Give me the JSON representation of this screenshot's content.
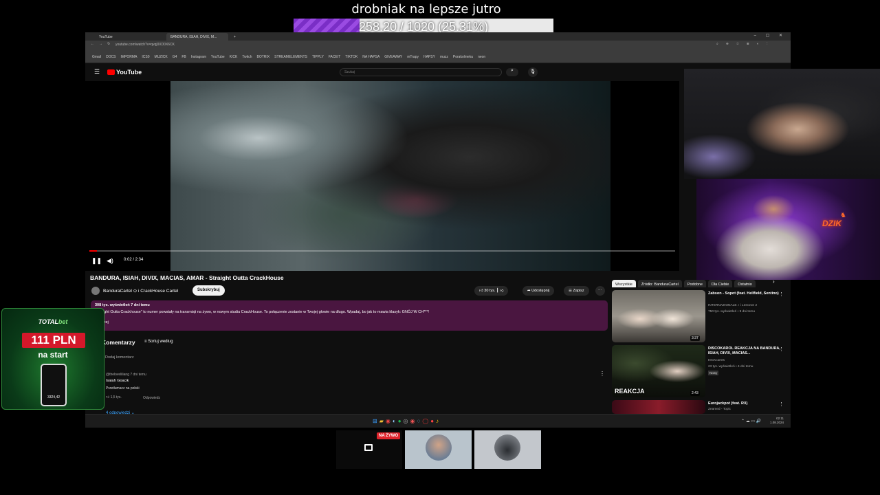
{
  "goal": {
    "title": "drobniak na lepsze jutro",
    "text": "258.20 / 1020 (25.31%)",
    "fraction": 0.2531
  },
  "browser": {
    "tabs": [
      "YouTube",
      "BANDURA, ISIAH, DIVIX, M..."
    ],
    "url": "youtube.com/watch?v=qvqj0XD0X6CK",
    "bookmarks": [
      "Gmail",
      "DOCS",
      "IMPORMA",
      "ICS0",
      "MUZICK",
      "G4",
      "FB",
      "Instagram",
      "YouTube",
      "KICK",
      "Twitch",
      "BOTRIX",
      "STREAMELEMENTS",
      "TIPPLY",
      "FACEIT",
      "TIKTOK",
      "NA HAPSA",
      "GIVEAWAY",
      "mTrapy",
      "HAPSY",
      "muzz",
      "Porakolmeku",
      "neon"
    ]
  },
  "youtube": {
    "logo": "YouTube",
    "search_placeholder": "Szukaj",
    "video": {
      "time": "0:02 / 2:34",
      "played_fraction": 0.013,
      "title": "BANDURA, ISIAH, DIVIX, MACIAS, AMAR - Straight Outta CrackHouse",
      "channel": "BanduraCartel ⊙ i CrackHouse Cartel",
      "subscribe": "Subskrybuj",
      "likes": "30 tys.",
      "share": "Udostępnij",
      "save": "Zapisz",
      "desc_stats": "308 tys. wyświetleń  7 dni temu",
      "desc_body": "\"Straight Outta Crackhouse\" to numer powstały na transmisji na żywo, w nowym studiu CrackHouse. To połączenie zostanie w Twojej głowie na długo. Wpadaj, bo jak to mawia klasyk: GNÓJ W CH***!",
      "desc_more": "...więcej"
    },
    "comments": {
      "heading": "Komentarzy",
      "sort": "Sortuj według",
      "add": "Dodaj komentarz",
      "user": "@theloveliliang  7 dni temu",
      "name": "Isaiah Goacik",
      "text": "Przetłumacz na polski",
      "likes": "1,5 tys.",
      "reply": "Odpowiedz",
      "replies": "4 odpowiedzi"
    },
    "chips": [
      "Wszystkie",
      "Źródło: BanduraCartel",
      "Podobne",
      "Dla Ciebie",
      "Ostatnio"
    ],
    "recommendations": [
      {
        "title": "Zabson - Sopot (feat. Hellfield, Sentino)",
        "channel": "INTERNAZIONALE ♪ i Leeczon 2",
        "meta": "750 tys. wyświetleń • 9 dni temu",
        "duration": "3:37",
        "badge": ""
      },
      {
        "title": "DISCOKAROL REAKCJA NA BANDURA, ISIAH, DIVIX, MACIAS...",
        "channel": "KICKcomts",
        "meta": "23 tys. wyświetleń • 4 dni temu",
        "duration": "2:43",
        "badge": "Nowy"
      },
      {
        "title": "Eurojackpot (feat. RX)",
        "channel": "Zeamed - Topic",
        "meta": "",
        "duration": "",
        "badge": ""
      }
    ]
  },
  "taskbar": {
    "clock_time": "02:11",
    "clock_date": "1.08.2024"
  },
  "ad": {
    "brand_a": "TOTAL",
    "brand_b": "bet",
    "amount": "111 PLN",
    "start": "na start",
    "phone_value": "3324,42"
  },
  "overlay": {
    "dzik": "DZIK",
    "live": "NA ŻYWO"
  }
}
